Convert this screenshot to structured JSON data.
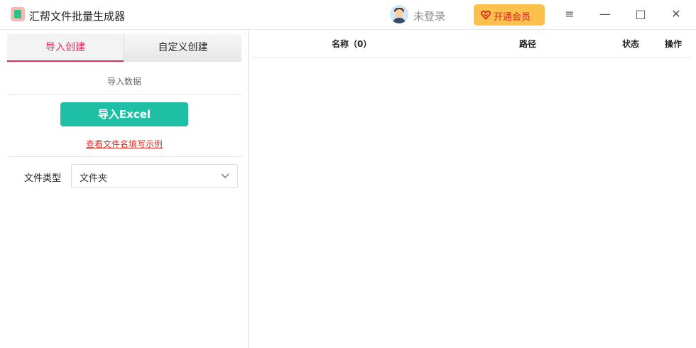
{
  "titlebar": {
    "title": "汇帮文件批量生成器",
    "login_text": "未登录",
    "vip_label": "开通会员",
    "controls": {
      "menu": "≡",
      "minimize": "—",
      "maximize": "□",
      "close": "✕"
    }
  },
  "left_panel": {
    "tabs": [
      {
        "label": "导入创建",
        "active": true
      },
      {
        "label": "自定义创建",
        "active": false
      }
    ],
    "section_label": "导入数据",
    "import_button": "导入Excel",
    "example_link": "查看文件名填写示例",
    "file_type": {
      "label": "文件类型",
      "selected": "文件夹"
    }
  },
  "table": {
    "columns": [
      "名称（0）",
      "路径",
      "状态",
      "操作"
    ],
    "rows": []
  },
  "colors": {
    "accent_tab": "#e2315e",
    "import_button": "#1fbfa5",
    "vip_background": "#fcc04d",
    "vip_text": "#d92a1c",
    "link": "#e0312b"
  },
  "icons": {
    "app_logo": "app-logo-icon",
    "avatar": "user-avatar-icon",
    "vip": "heart-diamond-icon",
    "dropdown": "chevron-down-icon"
  }
}
